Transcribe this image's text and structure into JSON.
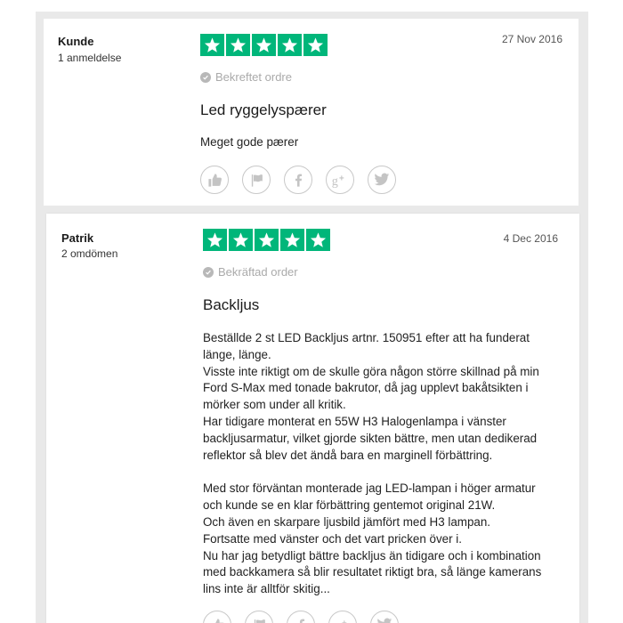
{
  "reviews": [
    {
      "author": "Kunde",
      "review_count": "1 anmeldelse",
      "date": "27 Nov 2016",
      "rating": 5,
      "verified_label": "Bekreftet ordre",
      "title": "Led ryggelyspærer",
      "body": [
        "Meget gode pærer"
      ],
      "actions": [
        "thumbs-up-icon",
        "flag-icon",
        "facebook-icon",
        "google-plus-icon",
        "twitter-icon"
      ]
    },
    {
      "author": "Patrik",
      "review_count": "2 omdömen",
      "date": "4 Dec 2016",
      "rating": 5,
      "verified_label": "Bekräftad order",
      "title": "Backljus",
      "body": [
        "Beställde 2 st LED Backljus artnr. 150951 efter att ha funderat",
        "länge, länge.",
        "Visste inte riktigt om de skulle göra någon större skillnad på min",
        "Ford S-Max med tonade bakrutor, då jag upplevt bakåtsikten i",
        "mörker som under all kritik.",
        "Har tidigare monterat en 55W H3 Halogenlampa i vänster",
        "backljusarmatur, vilket gjorde sikten bättre, men utan dedikerad",
        "reflektor så blev det ändå bara en marginell förbättring.",
        "",
        "Med stor förväntan monterade jag LED-lampan i höger armatur",
        "och kunde se en klar förbättring gentemot original 21W.",
        "Och även en skarpare ljusbild jämfört med H3 lampan.",
        "Fortsatte med vänster och det vart pricken över i.",
        "Nu har jag betydligt bättre backljus än tidigare och i kombination",
        "med backkamera så blir resultatet riktigt bra, så länge kamerans",
        "lins inte är alltför skitig..."
      ],
      "actions": [
        "thumbs-up-icon",
        "flag-icon",
        "facebook-icon",
        "google-plus-icon",
        "twitter-icon"
      ]
    }
  ],
  "colors": {
    "star_green": "#00b67a",
    "muted_text": "#aaaaaa",
    "page_background": "#e9e9e9"
  }
}
